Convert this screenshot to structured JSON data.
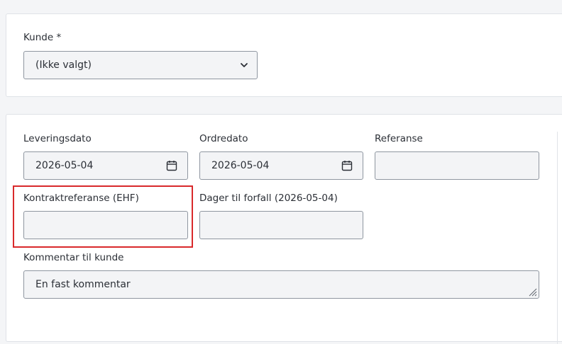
{
  "customer": {
    "label": "Kunde *",
    "selected": "(Ikke valgt)"
  },
  "fields": {
    "delivery_date": {
      "label": "Leveringsdato",
      "value": "2026-05-04"
    },
    "order_date": {
      "label": "Ordredato",
      "value": "2026-05-04"
    },
    "reference": {
      "label": "Referanse",
      "value": ""
    },
    "contract_reference": {
      "label": "Kontraktreferanse (EHF)",
      "value": ""
    },
    "days_due": {
      "label": "Dager til forfall (2026-05-04)",
      "value": ""
    },
    "comment": {
      "label": "Kommentar til kunde",
      "value": "En fast kommentar"
    }
  },
  "icons": {
    "select_chevron": "chevron-down-icon",
    "date_picker": "calendar-icon",
    "textarea_resize": "resize-handle-icon"
  },
  "colors": {
    "highlight": "#d9292b",
    "field_border": "#8f96a0",
    "field_background": "#f3f4f6"
  }
}
